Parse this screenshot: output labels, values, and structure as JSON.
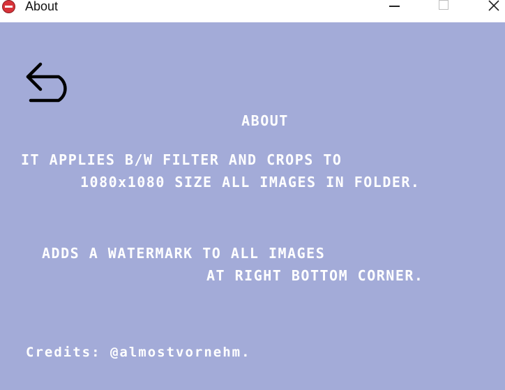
{
  "window": {
    "title": "About",
    "accent_color": "#a3abd8",
    "icon": "app-icon"
  },
  "controls": {
    "minimize_icon": "minimize-icon",
    "maximize_icon": "maximize-icon",
    "close_icon": "close-icon"
  },
  "about": {
    "back_icon": "back-arrow-icon",
    "heading": "ABOUT",
    "line1": "IT APPLIES B/W FILTER AND CROPS TO",
    "line2": "1080x1080 SIZE ALL IMAGES IN FOLDER.",
    "line3": "ADDS A WATERMARK TO ALL IMAGES",
    "line4": "AT RIGHT BOTTOM CORNER.",
    "credits": "Credits: @almostvornehm."
  }
}
